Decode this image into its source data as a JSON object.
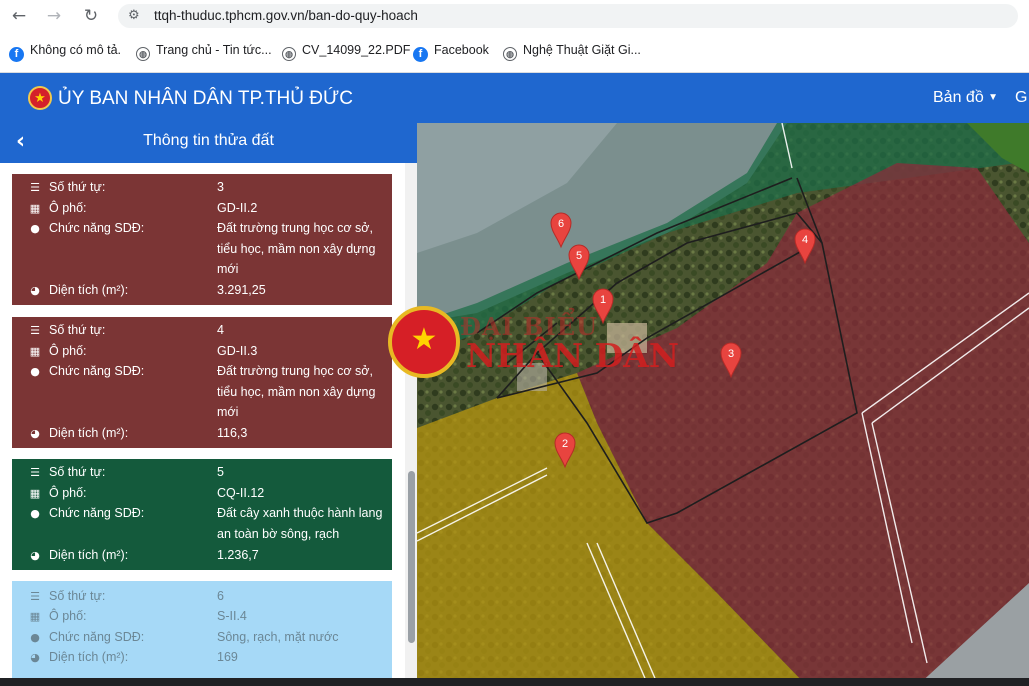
{
  "browser": {
    "url": "ttqh-thuduc.tphcm.gov.vn/ban-do-quy-hoach",
    "bookmarks": [
      {
        "label": "Không có mô tả.",
        "icon": "facebook-icon"
      },
      {
        "label": "Trang chủ - Tin tức...",
        "icon": "globe-icon"
      },
      {
        "label": "CV_14099_22.PDF",
        "icon": "globe-icon"
      },
      {
        "label": "Facebook",
        "icon": "facebook-icon"
      },
      {
        "label": "Nghệ Thuật Giặt Gi...",
        "icon": "globe-icon"
      }
    ]
  },
  "app": {
    "title": "ỦY BAN NHÂN DÂN TP.THỦ ĐỨC",
    "menu_map": "Bản đồ",
    "menu_next": "G",
    "accent": "#1f67cf"
  },
  "panel": {
    "title": "Thông tin thửa đất",
    "labels": {
      "stt": "Số thứ tự:",
      "opho": "Ô phố:",
      "chucnang": "Chức năng SDĐ:",
      "dientich": "Diện tích (m²):"
    },
    "cards": [
      {
        "stt": "3",
        "opho": "GD-II.2",
        "chucnang": "Đất trường trung học cơ sở, tiểu học, mầm non xây dựng mới",
        "dientich": "3.291,25",
        "color": "#7b3535"
      },
      {
        "stt": "4",
        "opho": "GD-II.3",
        "chucnang": "Đất trường trung học cơ sở, tiểu học, mầm non xây dựng mới",
        "dientich": "116,3",
        "color": "#7b3535"
      },
      {
        "stt": "5",
        "opho": "CQ-II.12",
        "chucnang": "Đất cây xanh thuộc hành lang an toàn bờ sông, rạch",
        "dientich": "1.236,7",
        "color": "#145a3c"
      },
      {
        "stt": "6",
        "opho": "S-II.4",
        "chucnang": "Sông, rạch, mặt nước",
        "dientich": "169",
        "color": "#a6d9f7"
      }
    ]
  },
  "map": {
    "markers": [
      "1",
      "2",
      "3",
      "4",
      "5",
      "6"
    ]
  },
  "watermark": {
    "line1": "ĐẠI BIỂU",
    "line2": "NHÂN DÂN"
  }
}
